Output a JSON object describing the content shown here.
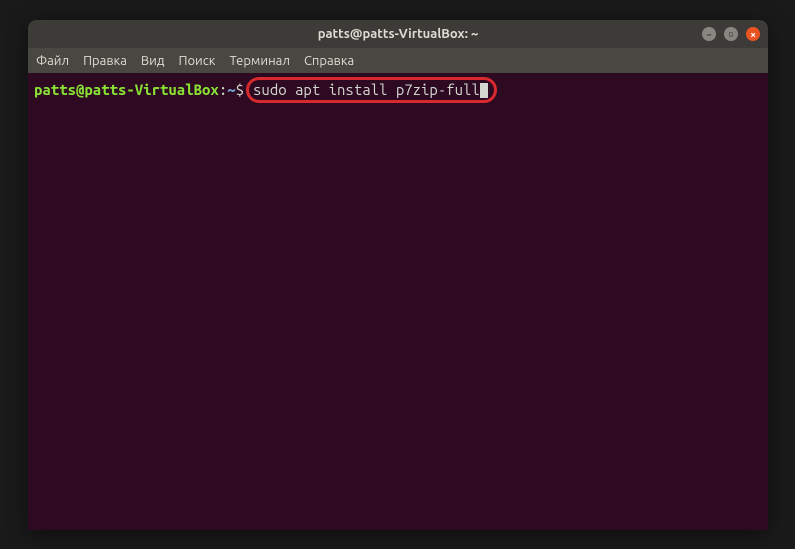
{
  "window": {
    "title": "patts@patts-VirtualBox: ~"
  },
  "menubar": {
    "items": [
      "Файл",
      "Правка",
      "Вид",
      "Поиск",
      "Терминал",
      "Справка"
    ]
  },
  "terminal": {
    "prompt": {
      "user_host": "patts@patts-VirtualBox",
      "colon": ":",
      "path": "~",
      "symbol": "$"
    },
    "command": "sudo apt install p7zip-full"
  }
}
